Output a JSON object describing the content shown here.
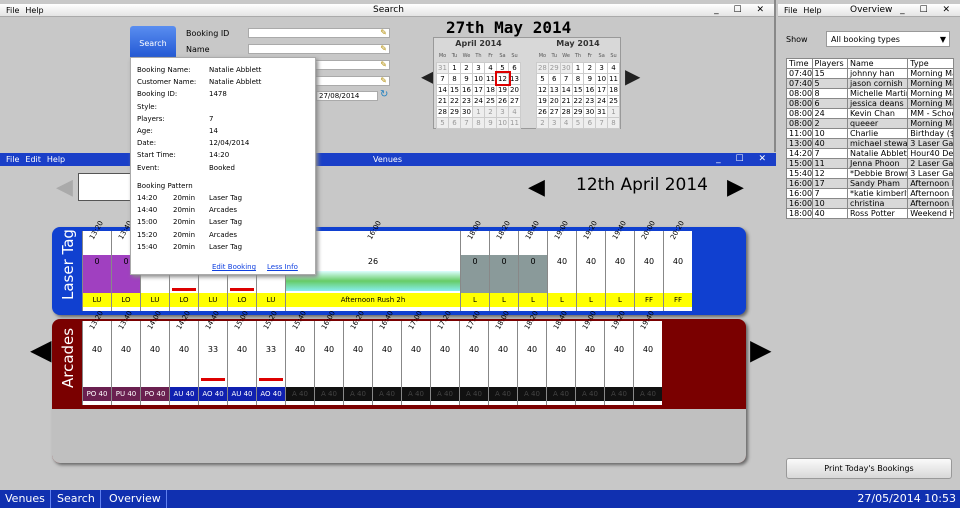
{
  "search_window": {
    "menu": [
      "File",
      "Help"
    ],
    "title": "Search",
    "search_label": "Search",
    "fields": [
      {
        "label": "Booking ID",
        "value": ""
      },
      {
        "label": "Name",
        "value": ""
      },
      {
        "label": "",
        "value": ""
      },
      {
        "label": "",
        "value": ""
      }
    ],
    "date_value": "27/08/2014",
    "date_title": "27th May 2014",
    "cal1": {
      "month": "April 2014",
      "weekdays": [
        "Mo",
        "Tu",
        "We",
        "Th",
        "Fr",
        "Sa",
        "Su"
      ],
      "rows": [
        [
          "31",
          "1",
          "2",
          "3",
          "4",
          "5",
          "6"
        ],
        [
          "7",
          "8",
          "9",
          "10",
          "11",
          "12",
          "13"
        ],
        [
          "14",
          "15",
          "16",
          "17",
          "18",
          "19",
          "20"
        ],
        [
          "21",
          "22",
          "23",
          "24",
          "25",
          "26",
          "27"
        ],
        [
          "28",
          "29",
          "30",
          "1",
          "2",
          "3",
          "4"
        ],
        [
          "5",
          "6",
          "7",
          "8",
          "9",
          "10",
          "11"
        ]
      ],
      "selected": "12"
    },
    "cal2": {
      "month": "May 2014",
      "weekdays": [
        "Mo",
        "Tu",
        "We",
        "Th",
        "Fr",
        "Sa",
        "Su"
      ],
      "rows": [
        [
          "28",
          "29",
          "30",
          "1",
          "2",
          "3",
          "4"
        ],
        [
          "5",
          "6",
          "7",
          "8",
          "9",
          "10",
          "11"
        ],
        [
          "12",
          "13",
          "14",
          "15",
          "16",
          "17",
          "18"
        ],
        [
          "19",
          "20",
          "21",
          "22",
          "23",
          "24",
          "25"
        ],
        [
          "26",
          "27",
          "28",
          "29",
          "30",
          "31",
          "1"
        ],
        [
          "2",
          "3",
          "4",
          "5",
          "6",
          "7",
          "8"
        ]
      ]
    }
  },
  "popup": {
    "rows": [
      [
        "Booking Name:",
        "Natalie Abblett"
      ],
      [
        "Customer Name:",
        "Natalie Abblett"
      ],
      [
        "Booking ID:",
        "1478"
      ],
      [
        "Style:",
        ""
      ],
      [
        "Players:",
        "7"
      ],
      [
        "Age:",
        "14"
      ],
      [
        "Date:",
        "12/04/2014"
      ],
      [
        "Start Time:",
        "14:20"
      ],
      [
        "Event:",
        "Booked"
      ]
    ],
    "pattern_title": "Booking Pattern",
    "pattern": [
      [
        "14:20",
        "20min",
        "Laser Tag"
      ],
      [
        "14:40",
        "20min",
        "Arcades"
      ],
      [
        "15:00",
        "20min",
        "Laser Tag"
      ],
      [
        "15:20",
        "20min",
        "Arcades"
      ],
      [
        "15:40",
        "20min",
        "Laser Tag"
      ]
    ],
    "edit_link": "Edit Booking",
    "less_link": "Less Info"
  },
  "venues_window": {
    "menu": [
      "File",
      "Edit",
      "Help"
    ],
    "title": "Venues",
    "date": "12th April 2014",
    "laser": {
      "label": "Laser Tag",
      "slots": [
        {
          "t": "13:20",
          "n": "0",
          "c": "LU",
          "bg": "#a040c0"
        },
        {
          "t": "13:40",
          "n": "0",
          "c": "LO",
          "bg": "#a040c0"
        },
        {
          "t": "14:00",
          "n": "",
          "c": "LU"
        },
        {
          "t": "14:20",
          "n": "",
          "c": "LO"
        },
        {
          "t": "14:40",
          "n": "",
          "c": "LU"
        },
        {
          "t": "15:00",
          "n": "",
          "c": "LO"
        },
        {
          "t": "15:20",
          "n": "",
          "c": "LU"
        },
        {
          "t": "16:00",
          "n": "26",
          "c": "Afternoon Rush 2h",
          "wide": true
        },
        {
          "t": "18:00",
          "n": "0",
          "c": "L",
          "bg": "#8a9a9a"
        },
        {
          "t": "18:20",
          "n": "0",
          "c": "L",
          "bg": "#8a9a9a"
        },
        {
          "t": "18:40",
          "n": "0",
          "c": "L",
          "bg": "#8a9a9a"
        },
        {
          "t": "19:00",
          "n": "40",
          "c": "L"
        },
        {
          "t": "19:20",
          "n": "40",
          "c": "L"
        },
        {
          "t": "19:40",
          "n": "40",
          "c": "L"
        },
        {
          "t": "20:00",
          "n": "40",
          "c": "FF"
        },
        {
          "t": "20:20",
          "n": "40",
          "c": "FF"
        }
      ]
    },
    "arcades": {
      "label": "Arcades",
      "slots": [
        {
          "t": "13:20",
          "n": "40",
          "c": "PO 40",
          "bg": "#6a2050"
        },
        {
          "t": "13:40",
          "n": "40",
          "c": "PU 40",
          "bg": "#6a2050"
        },
        {
          "t": "14:00",
          "n": "40",
          "c": "PO 40",
          "bg": "#6a2050"
        },
        {
          "t": "14:20",
          "n": "40",
          "c": "AU 40",
          "bg": "#1020b0"
        },
        {
          "t": "14:40",
          "n": "33",
          "c": "AO 40",
          "bg": "#1020b0"
        },
        {
          "t": "15:00",
          "n": "40",
          "c": "AU 40",
          "bg": "#1020b0"
        },
        {
          "t": "15:20",
          "n": "33",
          "c": "AO 40",
          "bg": "#1020b0"
        },
        {
          "t": "15:40",
          "n": "40",
          "c": "A 40"
        },
        {
          "t": "16:00",
          "n": "40",
          "c": "A 40"
        },
        {
          "t": "16:20",
          "n": "40",
          "c": "A 40"
        },
        {
          "t": "16:40",
          "n": "40",
          "c": "A 40"
        },
        {
          "t": "17:00",
          "n": "40",
          "c": "A 40"
        },
        {
          "t": "17:20",
          "n": "40",
          "c": "A 40"
        },
        {
          "t": "17:40",
          "n": "40",
          "c": "A 40"
        },
        {
          "t": "18:00",
          "n": "40",
          "c": "A 40"
        },
        {
          "t": "18:20",
          "n": "40",
          "c": "A 40"
        },
        {
          "t": "18:40",
          "n": "40",
          "c": "A 40"
        },
        {
          "t": "19:00",
          "n": "40",
          "c": "A 40"
        },
        {
          "t": "19:20",
          "n": "40",
          "c": "A 40"
        },
        {
          "t": "19:40",
          "n": "40",
          "c": "A 40"
        }
      ]
    }
  },
  "overview": {
    "menu": [
      "File",
      "Help"
    ],
    "title": "Overview",
    "show_label": "Show",
    "show_value": "All booking types",
    "headers": [
      "Time",
      "Players",
      "Name",
      "Type"
    ],
    "rows": [
      [
        "07:40",
        "15",
        "johnny han",
        "Morning Ma"
      ],
      [
        "07:40",
        "5",
        "jason cornish",
        "Morning Ma"
      ],
      [
        "08:00",
        "8",
        "Michelle Martin",
        "Morning Ma"
      ],
      [
        "08:00",
        "6",
        "jessica deans",
        "Morning Ma"
      ],
      [
        "08:00",
        "24",
        "Kevin Chan",
        "MM - Schoo"
      ],
      [
        "08:00",
        "2",
        "queeer",
        "Morning Ma"
      ],
      [
        "11:00",
        "10",
        "Charlie",
        "Birthday ($2"
      ],
      [
        "13:00",
        "40",
        "michael stewa",
        "3 Laser Gan"
      ],
      [
        "14:20",
        "7",
        "Natalie Abblett",
        "Hour40 Dea"
      ],
      [
        "15:00",
        "11",
        "Jenna Phoon",
        "2 Laser Gan"
      ],
      [
        "15:40",
        "12",
        "*Debbie Brown",
        "3 Laser Gan"
      ],
      [
        "16:00",
        "17",
        "Sandy Pham",
        "Afternoon R"
      ],
      [
        "16:00",
        "7",
        "*katie kimberly",
        "Afternoon R"
      ],
      [
        "16:00",
        "10",
        "christina",
        "Afternoon R"
      ],
      [
        "18:00",
        "40",
        "Ross Potter",
        "Weekend Ho"
      ]
    ],
    "print_label": "Print Today's Bookings"
  },
  "taskbar": {
    "items": [
      "Venues",
      "Search",
      "Overview"
    ],
    "clock": "27/05/2014 10:53"
  }
}
